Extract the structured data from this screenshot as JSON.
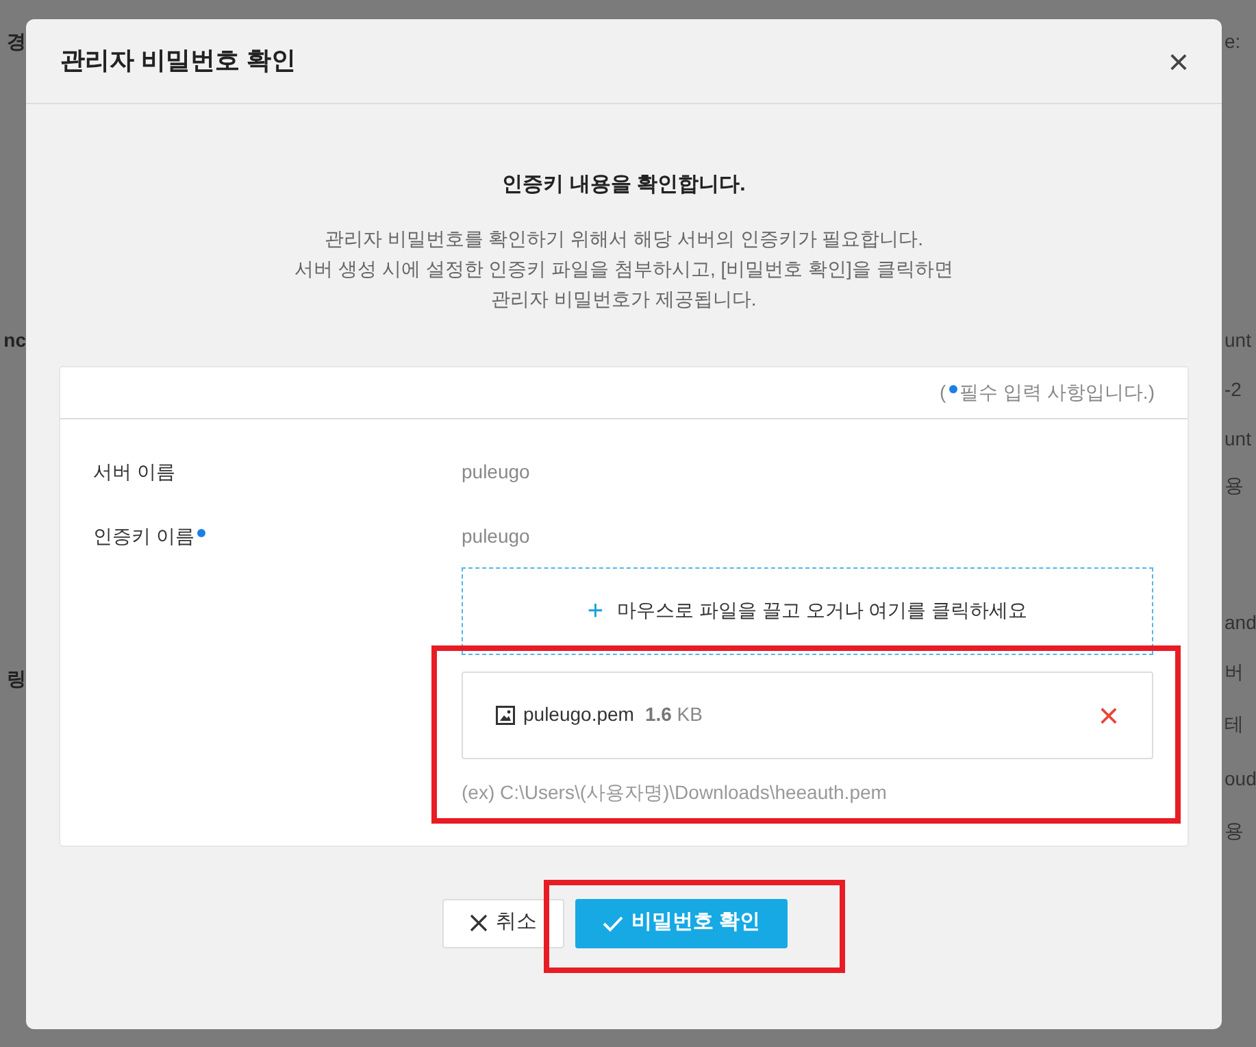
{
  "background": {
    "left_fragments": [
      "경",
      "nc",
      "링"
    ],
    "right_fragments": [
      "e:",
      "unt",
      "-2",
      "unt",
      "용",
      "and",
      "버",
      "테",
      "oud",
      "용"
    ]
  },
  "modal": {
    "title": "관리자 비밀번호 확인",
    "close": "×",
    "heading": "인증키 내용을 확인합니다.",
    "description": [
      "관리자 비밀번호를 확인하기 위해서 해당 서버의 인증키가 필요합니다.",
      "서버 생성 시에 설정한 인증키 파일을 첨부하시고, [비밀번호 확인]을 클릭하면",
      "관리자 비밀번호가 제공됩니다."
    ],
    "required_note": {
      "open": "(",
      "text": "필수 입력 사항입니다.)"
    },
    "fields": [
      {
        "label": "서버 이름",
        "required": false,
        "value": "puleugo"
      },
      {
        "label": "인증키 이름",
        "required": true,
        "value": "puleugo"
      }
    ],
    "dropzone": {
      "plus": "+",
      "text": "마우스로 파일을 끌고 오거나 여기를 클릭하세요"
    },
    "file": {
      "name": "puleugo.pem",
      "size": "1.6",
      "unit": "KB",
      "remove": "×",
      "highlighted": true
    },
    "hint": "(ex) C:\\Users\\(사용자명)\\Downloads\\heeauth.pem",
    "buttons": [
      {
        "kind": "cancel",
        "label": "취소",
        "highlighted": false
      },
      {
        "kind": "confirm",
        "label": "비밀번호 확인",
        "highlighted": true
      }
    ]
  }
}
